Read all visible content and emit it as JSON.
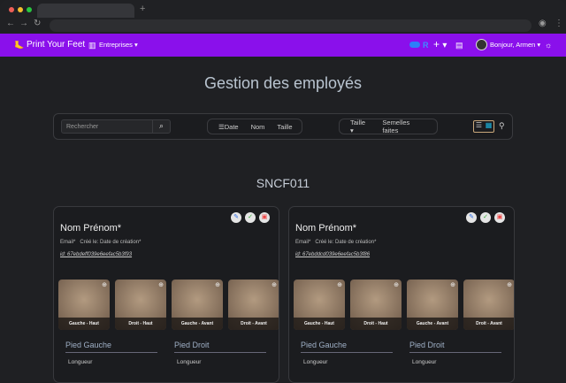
{
  "nav": {
    "brand": "Print Your Feet",
    "companies": "Entreprises",
    "greeting": "Bonjour, Armen"
  },
  "title": "Gestion des employés",
  "toolbar": {
    "search_placeholder": "Rechercher",
    "sort": [
      "Date",
      "Nom",
      "Taille"
    ],
    "filter_size": "Taille",
    "filter_insoles": "Semelles faites"
  },
  "section": "SNCF011",
  "cards": [
    {
      "name": "Nom Prénom*",
      "email": "Email*",
      "created": "Créé le: Date de création*",
      "id": "id: 67ebdeff039e6eefac5b3f93",
      "images": [
        "Gauche - Haut",
        "Droit - Haut",
        "Gauche - Avant",
        "Droit - Avant"
      ],
      "left": "Pied Gauche",
      "right": "Pied Droit",
      "length": "Longueur"
    },
    {
      "name": "Nom Prénom*",
      "email": "Email*",
      "created": "Créé le: Date de création*",
      "id": "id: 67ebddcd039e6eefac5b3f86",
      "images": [
        "Gauche - Haut",
        "Droit - Haut",
        "Gauche - Avant",
        "Droit - Avant"
      ],
      "left": "Pied Gauche",
      "right": "Pied Droit",
      "length": "Longueur"
    }
  ]
}
